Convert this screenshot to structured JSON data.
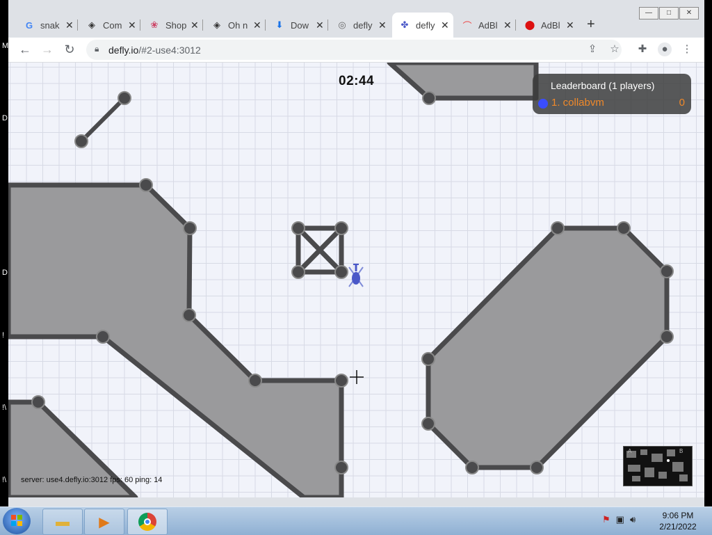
{
  "desktop": {
    "left_letters": [
      "M",
      "D",
      "D",
      "!",
      "!\\",
      "!\\"
    ]
  },
  "window": {
    "controls": [
      "—",
      "□",
      "✕"
    ]
  },
  "tabs": [
    {
      "title": "snak",
      "icon": "google-icon",
      "glyph": "G",
      "color": "#4285f4"
    },
    {
      "title": "Com",
      "icon": "collabvm-icon",
      "glyph": "◈",
      "color": "#333"
    },
    {
      "title": "Shop",
      "icon": "shop-icon",
      "glyph": "❀",
      "color": "#c46"
    },
    {
      "title": "Oh n",
      "icon": "collabvm-icon",
      "glyph": "◈",
      "color": "#333"
    },
    {
      "title": "Dow",
      "icon": "download-icon",
      "glyph": "⬇",
      "color": "#1a73e8"
    },
    {
      "title": "defly",
      "icon": "globe-icon",
      "glyph": "◎",
      "color": "#666"
    },
    {
      "title": "defly",
      "icon": "defly-icon",
      "glyph": "✤",
      "color": "#4a58c8",
      "active": true
    },
    {
      "title": "AdBl",
      "icon": "rainbow-icon",
      "glyph": "⌒",
      "color": "#e44"
    },
    {
      "title": "AdBl",
      "icon": "adblock-icon",
      "glyph": "⬤",
      "color": "#d11"
    }
  ],
  "toolbar": {
    "url_host": "defly.io",
    "url_rest": "/#2-use4:3012"
  },
  "game": {
    "timer": "02:44",
    "leaderboard_title": "Leaderboard (1 players)",
    "leaderboard": [
      {
        "name": "1. collabvm",
        "score": "0",
        "color": "#3a4dff"
      }
    ],
    "status": "server: use4.defly.io:3012 fps: 60 ping: 14",
    "minimap_labels": [
      "A",
      "B"
    ]
  },
  "taskbar": {
    "clock_time": "9:06 PM",
    "clock_date": "2/21/2022"
  }
}
